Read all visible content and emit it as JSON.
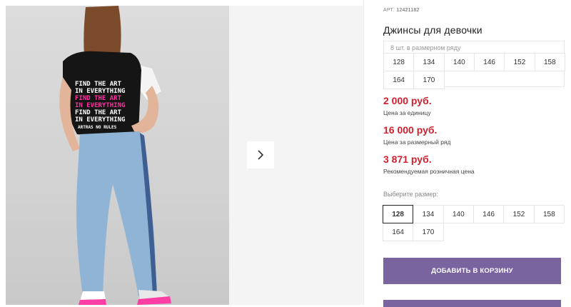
{
  "product": {
    "article_label": "АРТ.",
    "article_number": "12421182",
    "title": "Джинсы для девочки"
  },
  "size_row": {
    "caption": "8 шт. в размерном ряду",
    "sizes": [
      "128",
      "134",
      "140",
      "146",
      "152",
      "158",
      "164",
      "170"
    ]
  },
  "prices": {
    "unit_price": "2 000 руб.",
    "unit_label": "Цена за единицу",
    "row_price": "16 000 руб.",
    "row_label": "Цена за размерный ряд",
    "retail_price": "3 871 руб.",
    "retail_label": "Рекомендуемая розничная цена"
  },
  "size_select": {
    "label": "Выберите размер:",
    "sizes": [
      "128",
      "134",
      "140",
      "146",
      "152",
      "158",
      "164",
      "170"
    ],
    "selected": "128"
  },
  "actions": {
    "add_to_cart": "ДОБАВИТЬ В КОРЗИНУ"
  },
  "tshirt_print": [
    "FIND THE ART",
    "IN EVERYTHING",
    "FIND THE ART",
    "IN EVERYTHING",
    "FIND THE ART",
    "IN EVERYTHING",
    "ARTRAS NO RULES"
  ],
  "colors": {
    "price": "#d0202e",
    "button": "#7a64a0"
  }
}
